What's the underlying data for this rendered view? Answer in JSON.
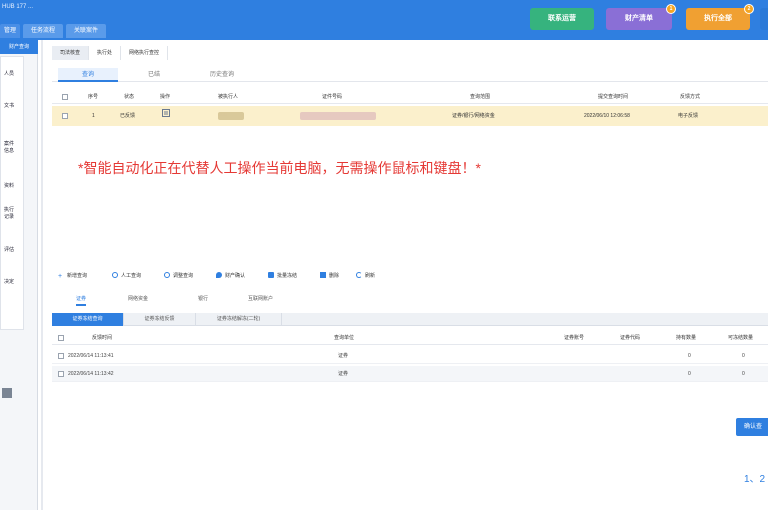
{
  "header": {
    "title": "HUB 177 ...",
    "tabs": [
      "管理",
      "任务流程",
      "关联案件"
    ],
    "buttons": [
      {
        "label": "联系运营",
        "color": "#36b37e",
        "badge": ""
      },
      {
        "label": "财产清单",
        "color": "#8a6fd6",
        "badge": "1"
      },
      {
        "label": "执行全部",
        "color": "#f0a032",
        "badge": "2"
      }
    ]
  },
  "sidebar": {
    "active": "财产查询",
    "items": [
      "人员",
      "文书",
      "案件\n信息",
      "资料",
      "执行\n记录",
      "评估",
      "决定"
    ]
  },
  "breadcrumbs": [
    "司法核查",
    "执行处",
    "网络执行查控"
  ],
  "subtabs": [
    "查询",
    "已结",
    "历史查询"
  ],
  "grid1": {
    "headers": [
      "序号",
      "状态",
      "操作",
      "被执行人",
      "证件号码",
      "查询范围",
      "提交查询时间",
      "反馈方式"
    ],
    "rows": [
      {
        "index": "1",
        "status": "已反馈",
        "name": "■■■",
        "id": "■■■■■■■■■■■■■■■■",
        "scope": "证券/银行/网络资金",
        "time": "2022/06/10 12:06:58",
        "mode": "电子反馈"
      }
    ]
  },
  "overlay_message": "*智能自动化正在代替人工操作当前电脑，无需操作鼠标和键盘！*",
  "toolbar": [
    "新增查询",
    "人工查询",
    "调整查询",
    "财产确认",
    "批量冻结",
    "删除",
    "刷新"
  ],
  "detail_tabs": [
    "证券",
    "网络资金",
    "银行",
    "互联网账户"
  ],
  "subgrid_tabs": [
    "证券冻结查询",
    "证券冻结反馈",
    "证券冻结解冻(二轮)"
  ],
  "grid2": {
    "headers": [
      "反馈时间",
      "查询单位",
      "证券账号",
      "证券代码",
      "持有数量",
      "可冻结数量"
    ],
    "rows": [
      {
        "time": "2022/06/14 11:13:41",
        "unit": "证券",
        "account": "",
        "code": "",
        "qty": "0",
        "freezable": "0"
      },
      {
        "time": "2022/06/14 11:13:42",
        "unit": "证券",
        "account": "",
        "code": "",
        "qty": "0",
        "freezable": "0"
      }
    ]
  },
  "confirm_button": "确认查",
  "pager": "1、2"
}
